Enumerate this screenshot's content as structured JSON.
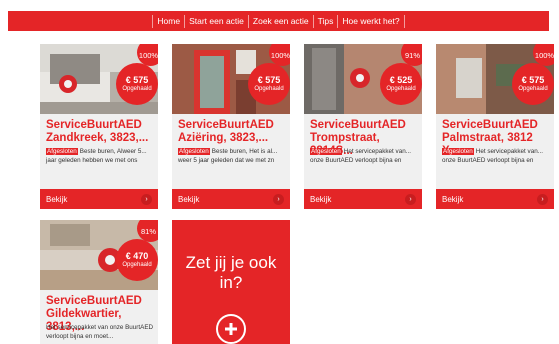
{
  "nav": {
    "items": [
      "Home",
      "Start een actie",
      "Zoek een actie",
      "Tips",
      "Hoe werkt het?"
    ]
  },
  "cards": [
    {
      "percent": "100%",
      "amount": "€ 575",
      "amount_label": "Opgehaald",
      "title": "ServiceBuurtAED Zandkreek, 3823,...",
      "tag": "Afgesloten",
      "description": "Beste buren, Alweer 5... jaar geleden hebben we met ons",
      "button": "Bekijk"
    },
    {
      "percent": "100%",
      "amount": "€ 575",
      "amount_label": "Opgehaald",
      "title": "ServiceBuurtAED Aziëring, 3823,...",
      "tag": "Afgesloten",
      "description": "Beste buren, Het is al... weer 5 jaar geleden dat we met zn",
      "button": "Bekijk"
    },
    {
      "percent": "91%",
      "amount": "€ 525",
      "amount_label": "Opgehaald",
      "title": "ServiceBuurtAED Trompstraat, 3814S...",
      "tag": "Afgesloten",
      "description": "Het servicepakket van... onze BuurtAED verloopt bijna en",
      "button": "Bekijk"
    },
    {
      "percent": "100%",
      "amount": "€ 575",
      "amount_label": "Opgehaald",
      "title": "ServiceBuurtAED Palmstraat, 3812 X...",
      "tag": "Afgesloten",
      "description": "Het servicepakket van... onze BuurtAED verloopt bijna en",
      "button": "Bekijk"
    },
    {
      "percent": "81%",
      "amount": "€ 470",
      "amount_label": "Opgehaald",
      "title": "ServiceBuurtAED Gildekwartier, 3813,...",
      "tag": "",
      "description": "Het servicepakket van onze BuurtAED verloopt bijna en moet...",
      "button": "Bekijk"
    }
  ],
  "cta": {
    "heading": "Zet jij je ook in?",
    "icon": "plus-circle-icon"
  },
  "colors": {
    "accent": "#e42527",
    "card_bg": "#f0f0f0"
  }
}
